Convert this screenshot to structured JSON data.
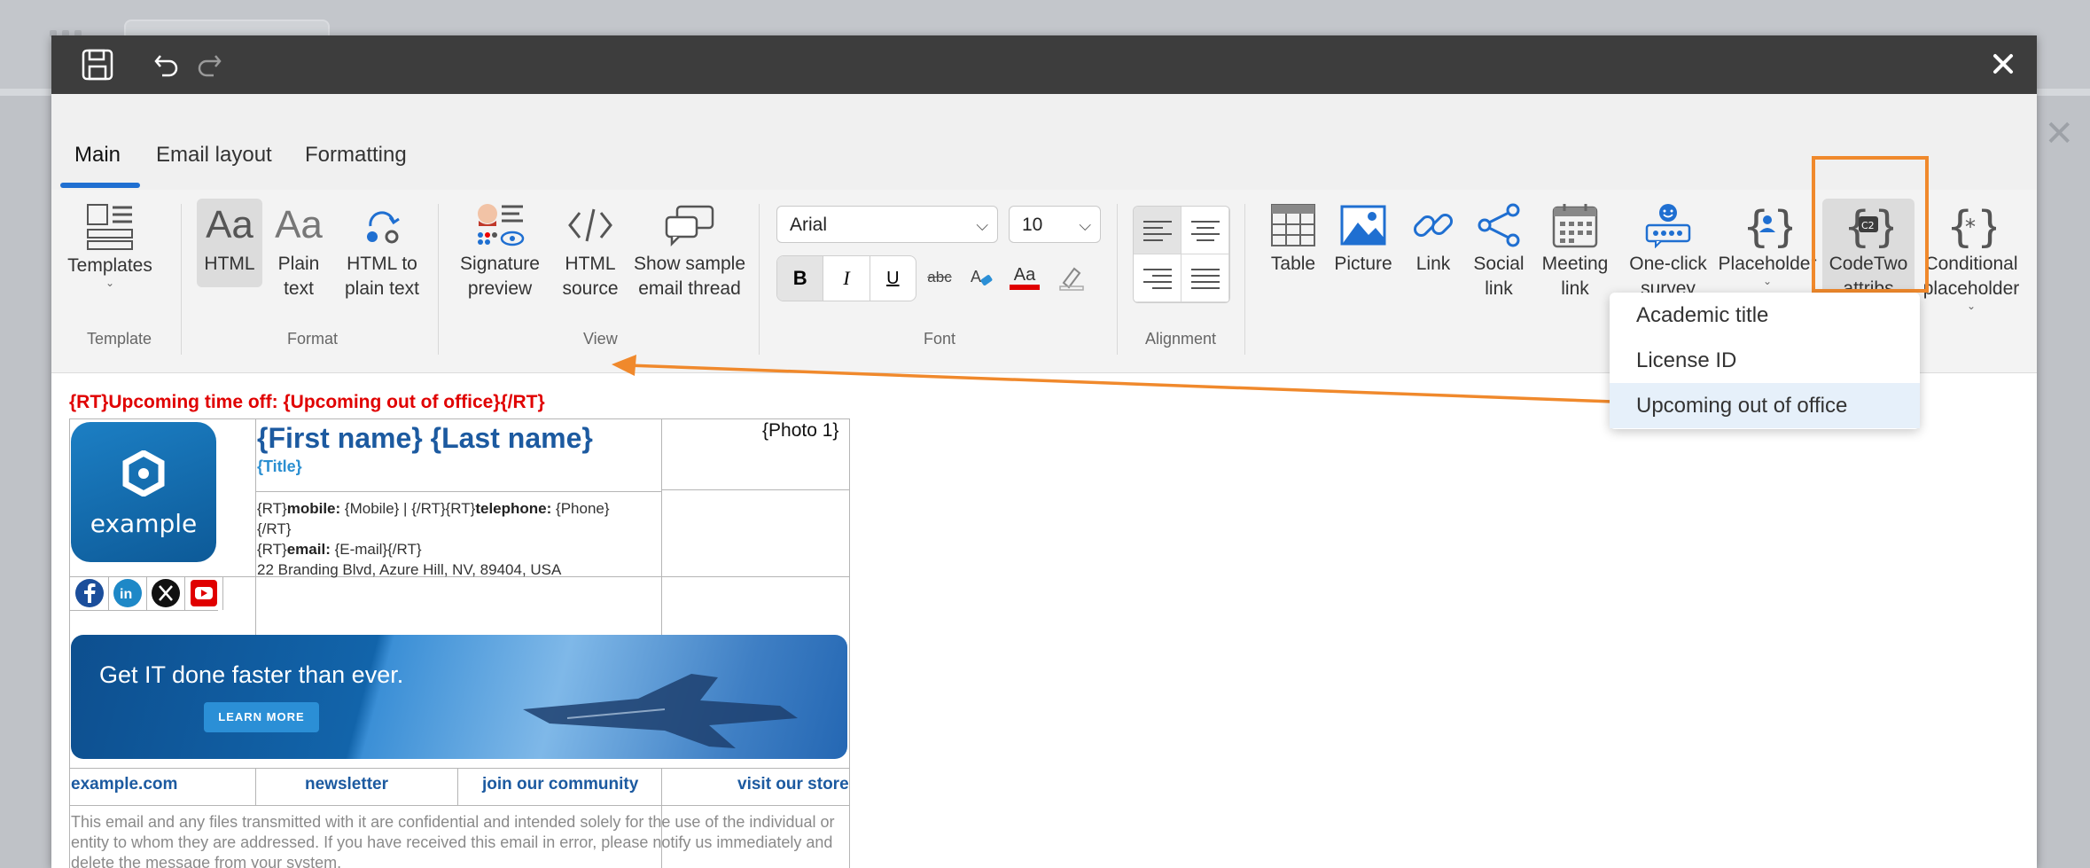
{
  "toolbar": {
    "save_icon": "save-icon",
    "undo_icon": "undo-icon",
    "redo_icon": "redo-icon",
    "close_icon": "close-icon"
  },
  "tabs": [
    {
      "label": "Main",
      "active": true
    },
    {
      "label": "Email layout",
      "active": false
    },
    {
      "label": "Formatting",
      "active": false
    }
  ],
  "ribbon": {
    "template": {
      "templates": "Templates",
      "group": "Template"
    },
    "format": {
      "html": "HTML",
      "plain_text": "Plain\ntext",
      "html_to_plain": "HTML to\nplain text",
      "group": "Format"
    },
    "view": {
      "signature_preview": "Signature\npreview",
      "html_source": "HTML\nsource",
      "show_sample": "Show sample\nemail thread",
      "group": "View"
    },
    "font": {
      "family": "Arial",
      "size": "10",
      "bold": "B",
      "italic": "I",
      "underline": "U",
      "strike": "abc",
      "color_glyph": "Aa",
      "group": "Font"
    },
    "alignment": {
      "group": "Alignment"
    },
    "insert": {
      "table": "Table",
      "picture": "Picture",
      "link": "Link",
      "social_link": "Social\nlink",
      "meeting_link": "Meeting\nlink",
      "one_click_survey": "One-click\nsurvey",
      "placeholder": "Placeholder",
      "codetwo_attribs": "CodeTwo\nattribs",
      "conditional_placeholder": "Conditional\nplaceholder",
      "codetwo_glyph": "C2"
    }
  },
  "dropdown": {
    "items": [
      {
        "label": "Academic title",
        "hover": false
      },
      {
        "label": "License ID",
        "hover": false
      },
      {
        "label": "Upcoming out of office",
        "hover": true
      }
    ]
  },
  "signature": {
    "rt_line": "{RT}Upcoming time off: {Upcoming out of office}{/RT}",
    "logo_text": "example",
    "name": "{First name} {Last name}",
    "title": "{Title}",
    "mobile_prefix": "{RT}",
    "mobile_label": "mobile:",
    "mobile_value": " {Mobile}  |  {/RT}{RT}",
    "telephone_label": "telephone:",
    "telephone_value": " {Phone}",
    "rt_close": "{/RT}",
    "email_prefix": "{RT}",
    "email_label": "email:",
    "email_value": " {E-mail}{/RT}",
    "address": "22 Branding Blvd, Azure Hill, NV, 89404, USA",
    "photo": "{Photo 1}",
    "banner_headline": "Get IT done faster than ever.",
    "banner_button": "LEARN MORE",
    "links": [
      "example.com",
      "newsletter",
      "join our community",
      "visit our store"
    ],
    "disclaimer": "This email and any files transmitted with it are confidential and intended solely for the use of the individual or entity to whom they are addressed. If you have received this email in error, please notify us immediately and delete the message from your system."
  },
  "colors": {
    "accent": "#1f6fd1",
    "highlight": "#f0892c",
    "rt_red": "#e00000",
    "name_blue": "#1c5aa0"
  }
}
